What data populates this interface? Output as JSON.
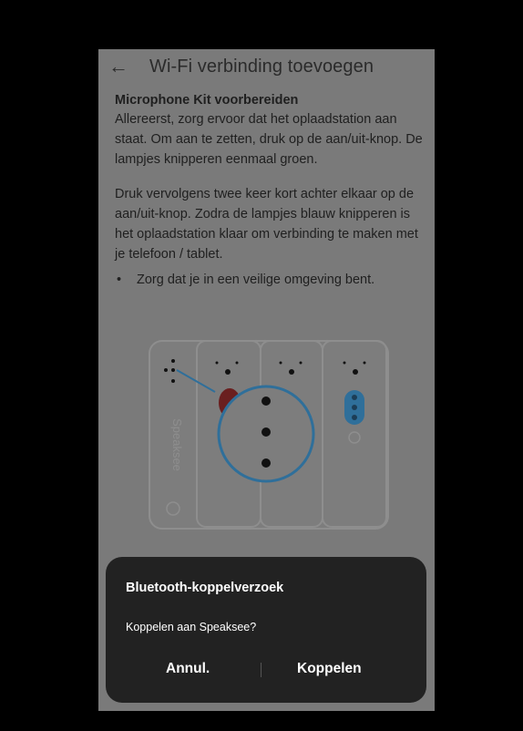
{
  "appbar": {
    "title": "Wi-Fi verbinding toevoegen",
    "back_icon": "arrow-left-icon"
  },
  "content": {
    "heading": "Microphone Kit voorbereiden",
    "paragraph1": "Allereerst, zorg ervoor dat het oplaadstation aan staat. Om aan te zetten, druk op de aan/uit-knop. De lampjes knipperen eenmaal groen.",
    "paragraph2": "Druk vervolgens twee keer kort achter elkaar op de aan/uit-knop. Zodra de lampjes blauw knipperen is het oplaadstation klaar om verbinding te maken met je telefoon / tablet.",
    "bullet1": "Zorg dat je in een veilige omgeving bent."
  },
  "illustration": {
    "brand_text": "Speaksee"
  },
  "dialog": {
    "title": "Bluetooth-koppelverzoek",
    "message": "Koppelen aan Speaksee?",
    "cancel_label": "Annul.",
    "pair_label": "Koppelen"
  },
  "colors": {
    "dialog_bg": "#222222",
    "overlay": "#7a7a7a",
    "accent_blue": "#4a9fd8"
  }
}
